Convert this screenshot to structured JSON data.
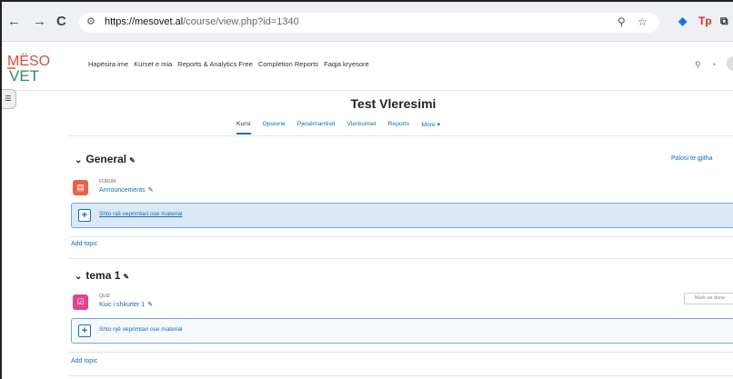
{
  "browser": {
    "back_icon": "←",
    "forward_icon": "→",
    "reload_icon": "C",
    "url_domain": "https://mesovet.al",
    "url_path": "/course/view.php?id=1340",
    "ext_tp": "Tp"
  },
  "site": {
    "logo_top": "MËSO",
    "logo_bottom": "VET",
    "nav": [
      "Hapësira ime",
      "Kurset e mia",
      "Reports & Analytics Free",
      "Completion Reports",
      "Faqja kryesore"
    ]
  },
  "course": {
    "title": "Test Vleresimi",
    "tabs": [
      "Kursi",
      "Opsione",
      "Pjesëmarrësit",
      "Vlerësimet",
      "Reports",
      "More ▾"
    ],
    "active_tab": 0
  },
  "collapse_all": "Palosi te gjitha",
  "sections": [
    {
      "title": "General",
      "activity": {
        "type": "FORUM",
        "name": "Announcements",
        "color": "#e8624a"
      },
      "add_label": "Shto një veprimtari ose material",
      "add_topic": "Add topic"
    },
    {
      "title": "tema 1",
      "activity": {
        "type": "QUIZ",
        "name": "Kuic i shkurter 1",
        "color": "#e0468c",
        "mark_done": "Mark as done"
      },
      "add_label": "Shto një veprimtari ose material",
      "add_topic": "Add topic"
    }
  ],
  "colors": {
    "link": "#0f6cbf",
    "logo_red": "#d84a3a",
    "logo_green": "#2e8a6a",
    "logo_orange": "#e8873a"
  }
}
